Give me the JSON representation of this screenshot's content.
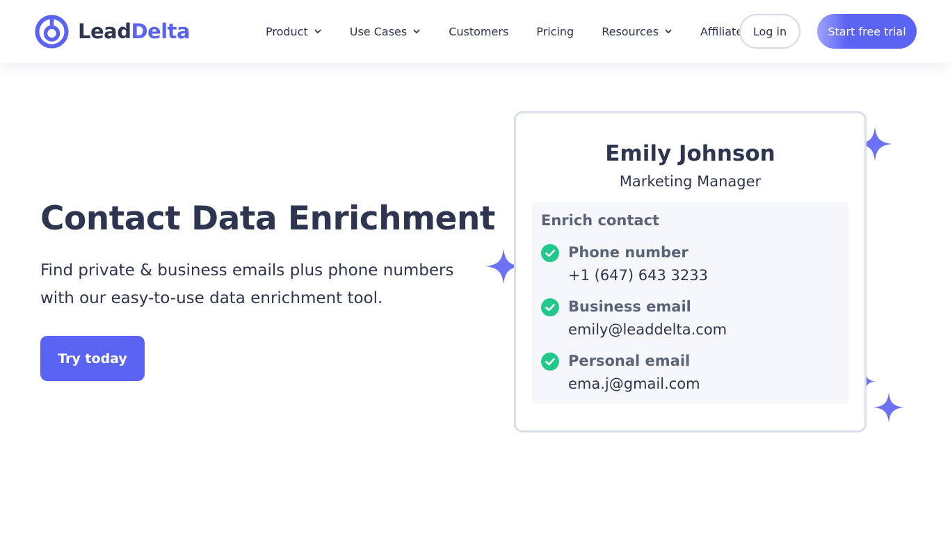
{
  "brand": {
    "name_part1": "Lead",
    "name_part2": "Delta",
    "accent": "#5b63f2",
    "text_color": "#2d3550"
  },
  "nav": {
    "items": [
      {
        "label": "Product",
        "has_dropdown": true
      },
      {
        "label": "Use Cases",
        "has_dropdown": true
      },
      {
        "label": "Customers",
        "has_dropdown": false
      },
      {
        "label": "Pricing",
        "has_dropdown": false
      },
      {
        "label": "Resources",
        "has_dropdown": true
      },
      {
        "label": "Affiliates",
        "has_dropdown": false
      }
    ],
    "login_label": "Log in",
    "trial_label": "Start free trial"
  },
  "hero": {
    "title": "Contact Data Enrichment",
    "subtitle": "Find private & business emails plus phone numbers with our easy-to-use data enrichment tool.",
    "cta_label": "Try today"
  },
  "card": {
    "name": "Emily Johnson",
    "role": "Marketing Manager",
    "enrich_title": "Enrich contact",
    "items": [
      {
        "label": "Phone number",
        "value": "+1 (647) 643 3233"
      },
      {
        "label": "Business email",
        "value": "emily@leaddelta.com"
      },
      {
        "label": "Personal email",
        "value": "ema.j@gmail.com"
      }
    ],
    "check_color": "#22c98a",
    "sparkle_color": "#6b72f5"
  }
}
